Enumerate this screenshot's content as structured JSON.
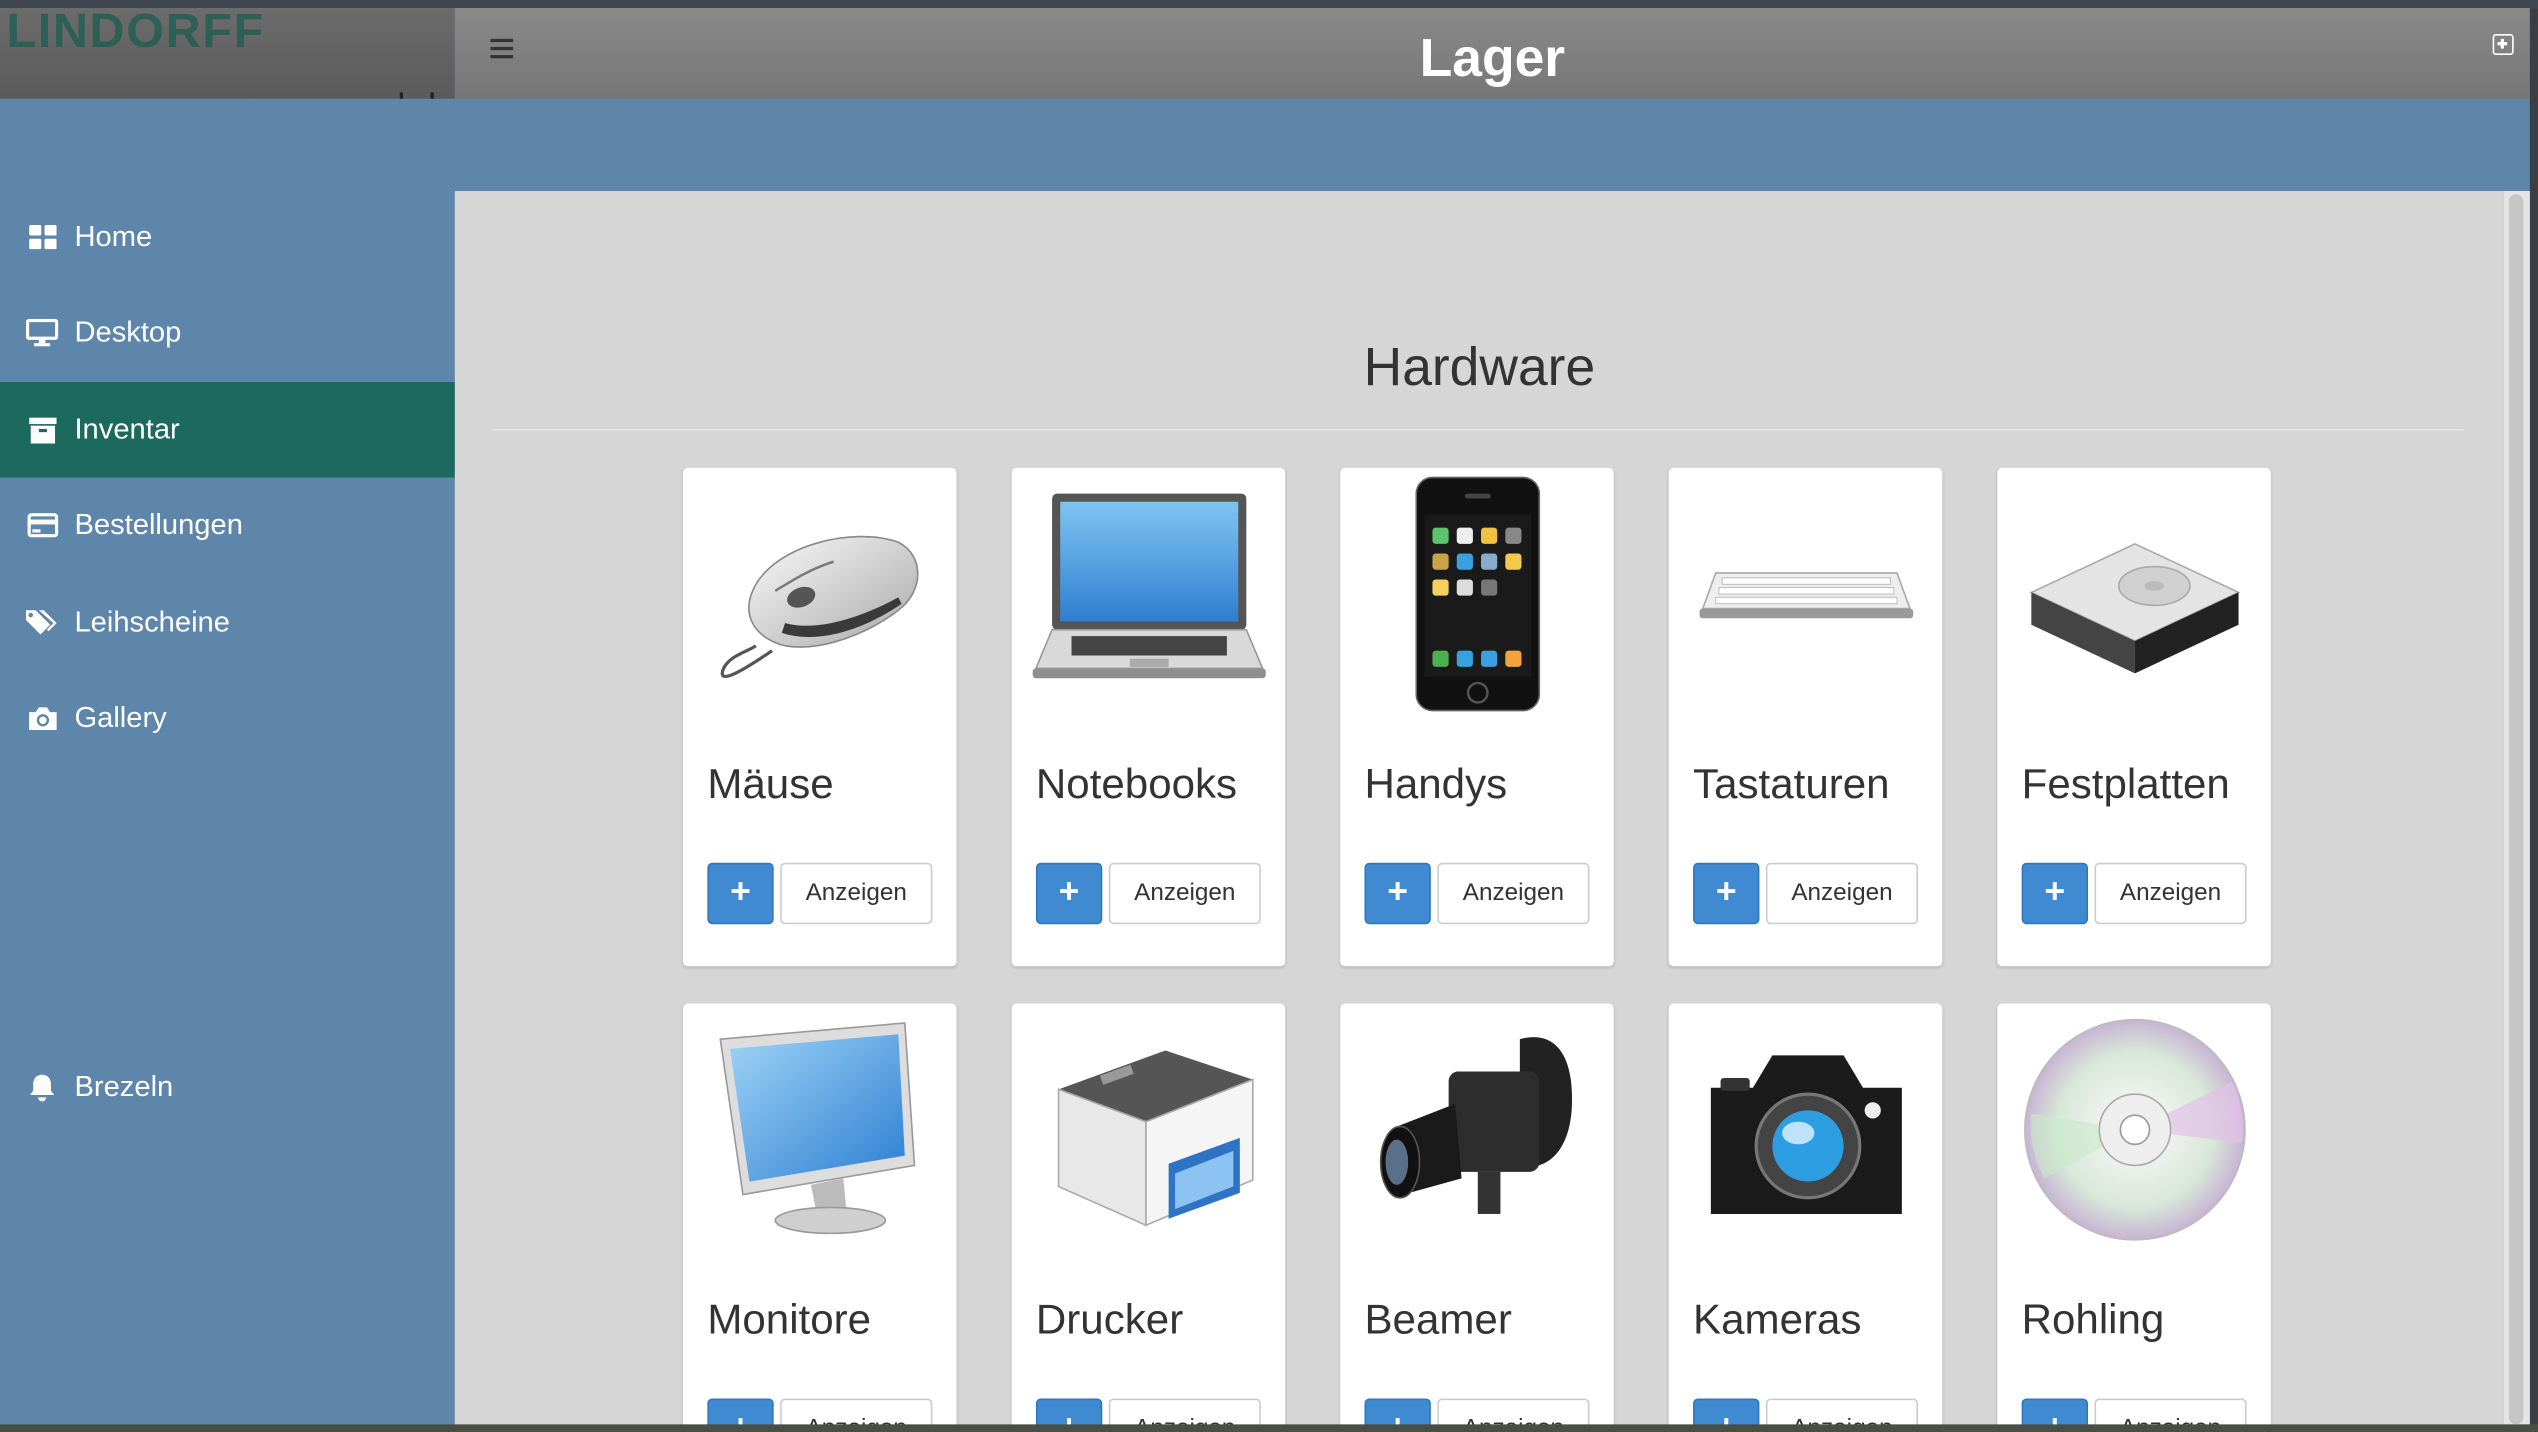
{
  "brand": {
    "logo_text": "LINDORFF"
  },
  "header": {
    "title": "Lager"
  },
  "sidebar": {
    "items": [
      {
        "label": "Home",
        "icon": "dashboard-icon",
        "active": false
      },
      {
        "label": "Desktop",
        "icon": "desktop-icon",
        "active": false
      },
      {
        "label": "Inventar",
        "icon": "archive-icon",
        "active": true
      },
      {
        "label": "Bestellungen",
        "icon": "credit-card-icon",
        "active": false
      },
      {
        "label": "Leihscheine",
        "icon": "tags-icon",
        "active": false
      },
      {
        "label": "Gallery",
        "icon": "camera-icon",
        "active": false
      }
    ],
    "footer_item": {
      "label": "Brezeln",
      "icon": "bell-icon"
    }
  },
  "main": {
    "section_title": "Hardware",
    "add_label": "+",
    "show_label": "Anzeigen",
    "cards": [
      {
        "title": "Mäuse",
        "icon": "mouse-icon"
      },
      {
        "title": "Notebooks",
        "icon": "laptop-icon"
      },
      {
        "title": "Handys",
        "icon": "phone-icon"
      },
      {
        "title": "Tastaturen",
        "icon": "keyboard-icon"
      },
      {
        "title": "Festplatten",
        "icon": "hard-drive-icon"
      },
      {
        "title": "Monitore",
        "icon": "monitor-icon"
      },
      {
        "title": "Drucker",
        "icon": "printer-icon"
      },
      {
        "title": "Beamer",
        "icon": "video-camera-icon"
      },
      {
        "title": "Kameras",
        "icon": "camera-icon"
      },
      {
        "title": "Rohling",
        "icon": "disc-icon"
      }
    ]
  },
  "colors": {
    "sidebar_bg": "#5d86aa",
    "active_item": "#1c6a5d",
    "primary_button": "#3f8ad0",
    "header_bg": "#808080",
    "panel_bg": "#d6d6d6"
  }
}
